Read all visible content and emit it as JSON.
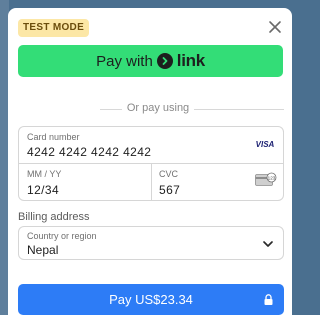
{
  "badge": {
    "label": "TEST MODE"
  },
  "link_button": {
    "prefix": "Pay with",
    "brand": "link"
  },
  "divider": {
    "label": "Or pay using"
  },
  "card": {
    "number_label": "Card number",
    "number_value": "4242 4242 4242 4242",
    "brand_icon": "VISA",
    "expiry_label": "MM / YY",
    "expiry_value": "12/34",
    "cvc_label": "CVC",
    "cvc_value": "567"
  },
  "billing": {
    "section_label": "Billing address",
    "country_label": "Country or region",
    "country_value": "Nepal"
  },
  "pay_button": {
    "label": "Pay US$23.34"
  },
  "colors": {
    "link_green": "#33dd77",
    "pay_blue": "#2d7cf6",
    "badge_yellow": "#fce7a6"
  }
}
